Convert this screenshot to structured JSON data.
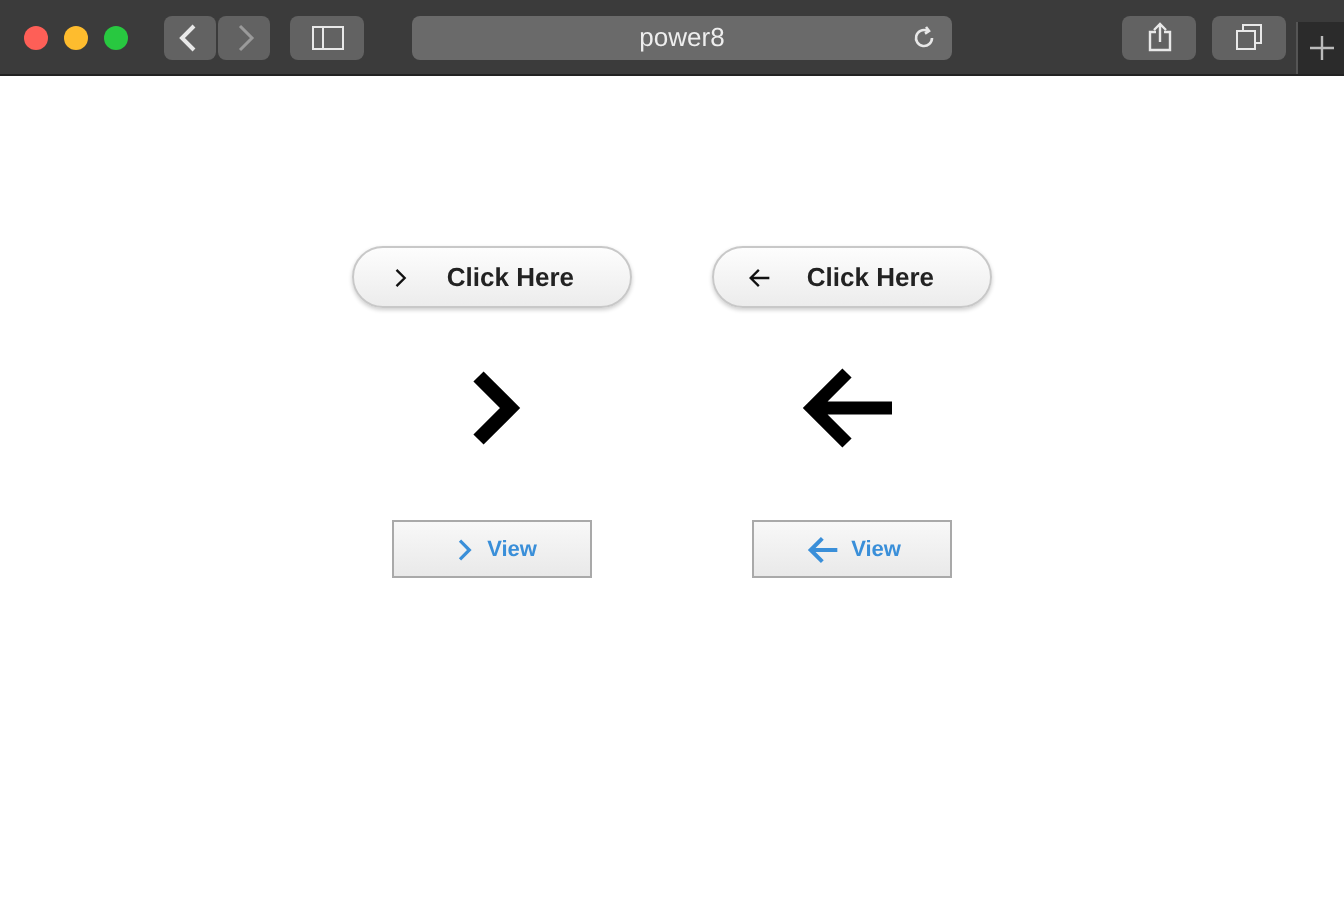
{
  "browser": {
    "address": "power8"
  },
  "demos": [
    {
      "kind": "chevron",
      "button_label": "Click Here",
      "view_label": "View"
    },
    {
      "kind": "arrow",
      "button_label": "Click Here",
      "view_label": "View"
    }
  ]
}
